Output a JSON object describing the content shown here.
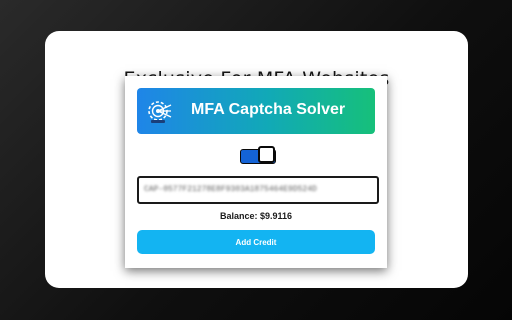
{
  "heading": "Exclusive For MFA Websites",
  "extension": {
    "title": "MFA Captcha Solver",
    "icon": "gear-arrow-icon",
    "toggle_state": "on",
    "api_key_value": "CAP-0577F21278E8F9303A1875464E9D524D",
    "balance_text": "Balance: $9.9116",
    "add_credit_label": "Add Credit"
  },
  "colors": {
    "banner_gradient_start": "#1f85e8",
    "banner_gradient_end": "#16c07a",
    "toggle_on": "#1463d6",
    "button": "#13b4f2"
  }
}
